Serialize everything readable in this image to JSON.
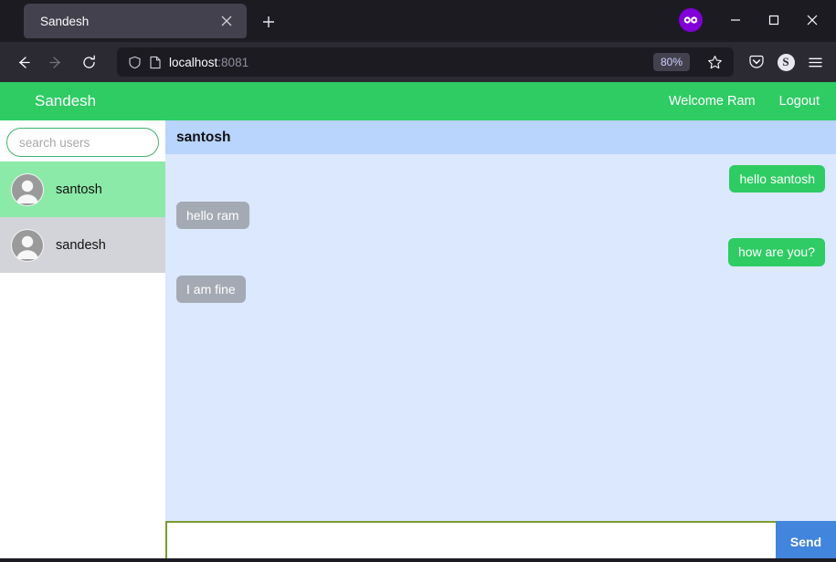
{
  "browser": {
    "tab": {
      "title": "Sandesh",
      "close_icon": "close-icon"
    },
    "new_tab_label": "+",
    "window_controls": {
      "minimize": "–",
      "maximize": "☐",
      "close": "✕"
    },
    "private_badge_icon": "private-mask-icon",
    "nav": {
      "back_icon": "back-arrow-icon",
      "forward_icon": "forward-arrow-icon",
      "reload_icon": "reload-icon"
    },
    "url": {
      "host": "localhost",
      "port": ":8081",
      "shield_icon": "shield-icon",
      "page_icon": "page-icon"
    },
    "zoom_level": "80%",
    "bookmark_icon": "star-icon",
    "pocket_icon": "pocket-icon",
    "account_icon_letter": "S",
    "menu_icon": "hamburger-menu-icon"
  },
  "app": {
    "brand": "Sandesh",
    "nav_links": [
      {
        "label": "Welcome Ram"
      },
      {
        "label": "Logout"
      }
    ],
    "accent_green": "#2ecc63",
    "selected_user_green": "#8ceaa8",
    "chat_header_blue": "#b9d4fd",
    "chat_body_blue": "#dbe8fe",
    "send_button_blue": "#4285dd"
  },
  "sidebar": {
    "search": {
      "placeholder": "search users",
      "value": ""
    },
    "users": [
      {
        "name": "santosh",
        "selected": true
      },
      {
        "name": "sandesh",
        "selected": false
      }
    ]
  },
  "chat": {
    "header_name": "santosh",
    "messages": [
      {
        "text": "hello santosh",
        "direction": "out"
      },
      {
        "text": "hello ram",
        "direction": "in"
      },
      {
        "text": "how are you?",
        "direction": "out"
      },
      {
        "text": "I am fine",
        "direction": "in"
      }
    ],
    "composer": {
      "value": "",
      "placeholder": "",
      "send_label": "Send"
    }
  }
}
